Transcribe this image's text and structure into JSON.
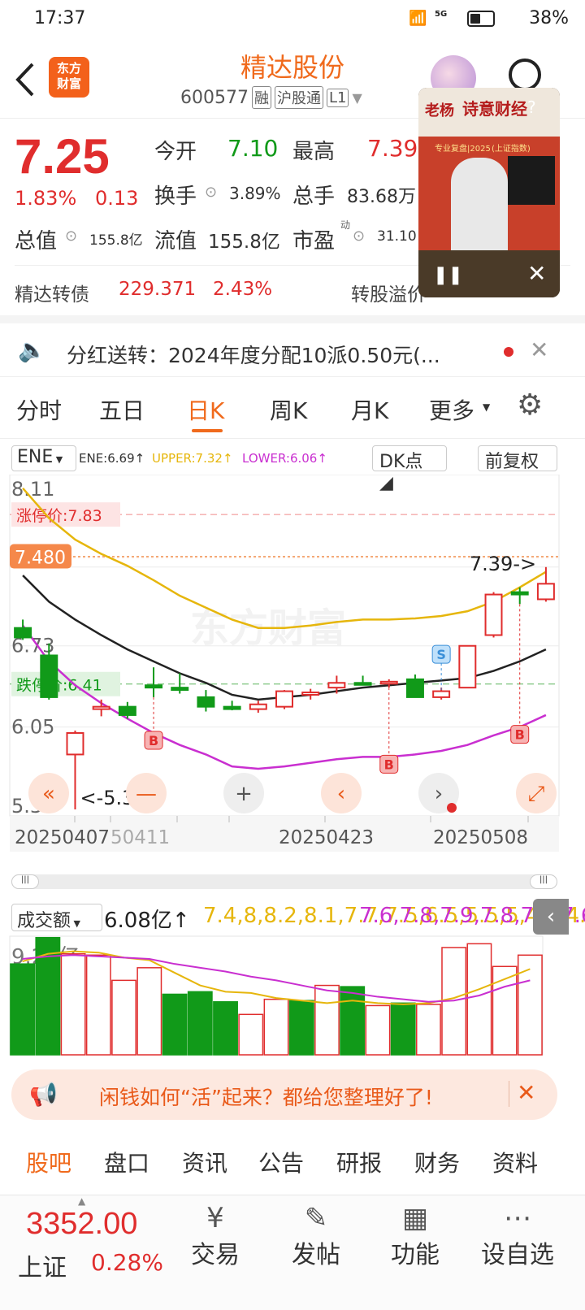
{
  "status": {
    "time": "17:37",
    "battery": "38%",
    "net": "5G"
  },
  "header": {
    "title": "精达股份",
    "code": "600577",
    "tags": [
      "融",
      "沪股通",
      "L1"
    ],
    "logo_line1": "东方",
    "logo_line2": "财富"
  },
  "quote": {
    "price": "7.25",
    "pct": "1.83%",
    "chg": "0.13",
    "open_label": "今开",
    "open": "7.10",
    "high_label": "最高",
    "high": "7.39",
    "turnover_label": "换手",
    "turnover": "3.89%",
    "volume_label": "总手",
    "volume": "83.68万",
    "mktcap_label": "总值",
    "mktcap": "155.8亿",
    "float_label": "流值",
    "float": "155.8亿",
    "pe_label": "市盈",
    "pe_sup": "动",
    "pe": "31.10"
  },
  "bond": {
    "name": "精达转债",
    "price": "229.371",
    "pct": "2.43%",
    "premium_label": "转股溢价"
  },
  "video": {
    "brand": "老杨",
    "brand2": "诗意财经",
    "banner": "专业复盘|2025",
    "sub": "(上证指数)"
  },
  "notice": {
    "text": "分红送转：2024年度分配10派0.50元(..."
  },
  "tabs": [
    "分时",
    "五日",
    "日K",
    "周K",
    "月K",
    "更多"
  ],
  "indicator": {
    "name": "ENE",
    "ene": "ENE:6.69↑",
    "upper": "UPPER:7.32↑",
    "lower": "LOWER:6.06↑",
    "dk": "DK点",
    "adj": "前复权"
  },
  "kchart": {
    "y_labels": [
      "8.11",
      "6.73",
      "6.05",
      "5.36"
    ],
    "limit_up": "涨停价:7.83",
    "limit_down": "跌停价:6.41",
    "cur_tag": "7.480",
    "high_ann": "7.39->",
    "low_ann": "<-5.36",
    "dates": [
      "20250407",
      "20250411",
      "20250423",
      "20250508"
    ],
    "watermark": "东方财富"
  },
  "chart_data": {
    "type": "candlestick",
    "ylim": [
      5.36,
      8.11
    ],
    "candles": [
      {
        "o": 6.88,
        "h": 6.95,
        "l": 6.78,
        "c": 6.8
      },
      {
        "o": 6.65,
        "h": 6.75,
        "l": 6.28,
        "c": 6.3
      },
      {
        "o": 5.82,
        "h": 6.02,
        "l": 5.36,
        "c": 6.0
      },
      {
        "o": 6.2,
        "h": 6.28,
        "l": 6.14,
        "c": 6.22
      },
      {
        "o": 6.22,
        "h": 6.26,
        "l": 6.12,
        "c": 6.15
      },
      {
        "o": 6.4,
        "h": 6.55,
        "l": 6.3,
        "c": 6.38
      },
      {
        "o": 6.38,
        "h": 6.5,
        "l": 6.33,
        "c": 6.36
      },
      {
        "o": 6.3,
        "h": 6.36,
        "l": 6.18,
        "c": 6.22
      },
      {
        "o": 6.22,
        "h": 6.27,
        "l": 6.19,
        "c": 6.2
      },
      {
        "o": 6.2,
        "h": 6.27,
        "l": 6.17,
        "c": 6.24
      },
      {
        "o": 6.22,
        "h": 6.36,
        "l": 6.2,
        "c": 6.35
      },
      {
        "o": 6.32,
        "h": 6.37,
        "l": 6.28,
        "c": 6.34
      },
      {
        "o": 6.38,
        "h": 6.48,
        "l": 6.33,
        "c": 6.42
      },
      {
        "o": 6.42,
        "h": 6.48,
        "l": 6.4,
        "c": 6.41
      },
      {
        "o": 6.42,
        "h": 6.45,
        "l": 6.38,
        "c": 6.43
      },
      {
        "o": 6.45,
        "h": 6.49,
        "l": 6.38,
        "c": 6.3
      },
      {
        "o": 6.3,
        "h": 6.38,
        "l": 6.28,
        "c": 6.35
      },
      {
        "o": 6.38,
        "h": 6.73,
        "l": 6.38,
        "c": 6.73
      },
      {
        "o": 6.82,
        "h": 7.18,
        "l": 6.8,
        "c": 7.16
      },
      {
        "o": 7.18,
        "h": 7.22,
        "l": 7.08,
        "c": 7.16
      },
      {
        "o": 7.12,
        "h": 7.39,
        "l": 7.1,
        "c": 7.25
      }
    ],
    "upper": [
      8.05,
      7.8,
      7.62,
      7.5,
      7.4,
      7.28,
      7.15,
      7.05,
      6.95,
      6.88,
      6.88,
      6.9,
      6.93,
      6.95,
      6.95,
      6.96,
      6.98,
      7.02,
      7.1,
      7.22,
      7.35
    ],
    "ene": [
      7.32,
      7.1,
      6.95,
      6.82,
      6.7,
      6.6,
      6.5,
      6.42,
      6.32,
      6.28,
      6.3,
      6.32,
      6.35,
      6.38,
      6.4,
      6.42,
      6.44,
      6.46,
      6.52,
      6.6,
      6.7
    ],
    "lower": [
      6.9,
      6.6,
      6.4,
      6.25,
      6.12,
      6.0,
      5.9,
      5.82,
      5.72,
      5.7,
      5.72,
      5.75,
      5.78,
      5.8,
      5.8,
      5.82,
      5.85,
      5.9,
      5.98,
      6.05,
      6.15
    ]
  },
  "volume": {
    "label": "成交额",
    "value": "6.08亿↑",
    "ma1": [
      7.4,
      8.0,
      8.2,
      8.1,
      7.7,
      7.5,
      6.5,
      5.5,
      5.0,
      4.9,
      4.5,
      4.3,
      4.1,
      4.3,
      4.1,
      4.0,
      4.1,
      4.5,
      5.2,
      6.0,
      6.8
    ],
    "ma2": [
      7.6,
      7.8,
      7.9,
      7.8,
      7.7,
      7.6,
      7.2,
      6.9,
      6.6,
      6.2,
      5.9,
      5.5,
      5.1,
      4.9,
      4.6,
      4.4,
      4.2,
      4.3,
      4.7,
      5.4,
      5.9
    ],
    "max": "9.29亿",
    "bars": [
      7.2,
      9.29,
      8.0,
      7.9,
      5.9,
      6.9,
      4.8,
      5.0,
      4.2,
      3.2,
      4.4,
      4.3,
      5.5,
      5.4,
      3.9,
      4.1,
      4.0,
      8.5,
      8.8,
      7.0,
      7.9
    ],
    "up": [
      false,
      false,
      true,
      true,
      true,
      true,
      false,
      false,
      false,
      true,
      true,
      false,
      true,
      false,
      true,
      false,
      true,
      true,
      true,
      true,
      true
    ]
  },
  "ad": {
    "text": "闲钱如何“活”起来？都给您整理好了!"
  },
  "subtabs": [
    "股吧",
    "盘口",
    "资讯",
    "公告",
    "研报",
    "财务",
    "资料"
  ],
  "bottom": {
    "index_value": "3352.00",
    "index_name": "上证",
    "index_pct": "0.28%",
    "items": [
      "交易",
      "发帖",
      "功能",
      "设自选"
    ]
  },
  "colors": {
    "up": "#e02d2d",
    "down": "#119a19",
    "accent": "#f06a1c",
    "upper": "#e6b60c",
    "lower": "#c92fd0"
  }
}
